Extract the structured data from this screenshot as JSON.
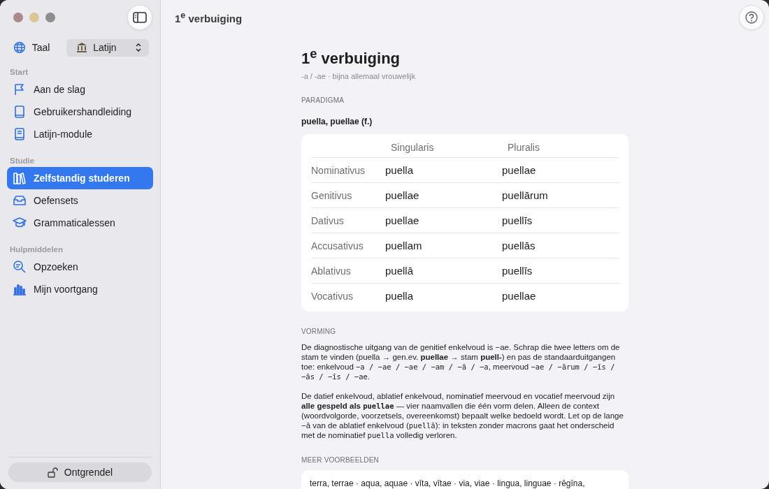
{
  "sidebar": {
    "language": {
      "label": "Taal",
      "value": "Latijn"
    },
    "sections": [
      {
        "title": "Start",
        "items": [
          {
            "label": "Aan de slag",
            "kind": "flag",
            "selected": false
          },
          {
            "label": "Gebruikershandleiding",
            "kind": "book",
            "selected": false
          },
          {
            "label": "Latijn-module",
            "kind": "bookpage",
            "selected": false
          }
        ]
      },
      {
        "title": "Studie",
        "items": [
          {
            "label": "Zelfstandig studeren",
            "kind": "library",
            "selected": true
          },
          {
            "label": "Oefensets",
            "kind": "tray",
            "selected": false
          },
          {
            "label": "Grammaticalessen",
            "kind": "cap",
            "selected": false
          }
        ]
      },
      {
        "title": "Hulpmiddelen",
        "items": [
          {
            "label": "Opzoeken",
            "kind": "search",
            "selected": false
          },
          {
            "label": "Mijn voortgang",
            "kind": "chart",
            "selected": false
          }
        ]
      }
    ],
    "unlock_button": "Ontgrendel"
  },
  "toolbar": {
    "title": "1$^{e}$ verbuiging"
  },
  "page": {
    "title": "1$^{e}$ verbuiging",
    "subtitle": "-a / -ae · bijna allemaal vrouwelijk",
    "paradigm_heading": "PARADIGMA",
    "lemma": "puella, puellae (f.)",
    "table": {
      "columns": [
        "Singularis",
        "Pluralis"
      ],
      "rows": [
        {
          "case": "Nominativus",
          "singular": "puella",
          "plural": "puellae"
        },
        {
          "case": "Genitivus",
          "singular": "puellae",
          "plural": "puellārum"
        },
        {
          "case": "Dativus",
          "singular": "puellae",
          "plural": "puellīs"
        },
        {
          "case": "Accusativus",
          "singular": "puellam",
          "plural": "puellās"
        },
        {
          "case": "Ablativus",
          "singular": "puellā",
          "plural": "puellīs"
        },
        {
          "case": "Vocativus",
          "singular": "puella",
          "plural": "puellae"
        }
      ]
    },
    "formation_heading": "VORMING",
    "paragraphs": [
      [
        {
          "kind": "plain",
          "text": "De diagnostische uitgang van de genitief enkelvoud is −ae. Schrap die twee letters om de stam te vinden (puella → gen.ev. "
        },
        {
          "kind": "bold",
          "text": "puellae"
        },
        {
          "kind": "plain",
          "text": " → stam "
        },
        {
          "kind": "bold",
          "text": "puell-"
        },
        {
          "kind": "plain",
          "text": ") en pas de standaarduitgangen toe: enkelvoud "
        },
        {
          "kind": "mono",
          "text": "−a / −ae / −ae / −am / −ā / −a"
        },
        {
          "kind": "plain",
          "text": ", meervoud "
        },
        {
          "kind": "mono",
          "text": "−ae / −ārum / −īs / −ās / −īs / −ae"
        },
        {
          "kind": "plain",
          "text": "."
        }
      ],
      [
        {
          "kind": "plain",
          "text": "De datief enkelvoud, ablatief enkelvoud, nominatief meervoud en vocatief meervoud zijn "
        },
        {
          "kind": "bold",
          "text": "alle gespeld als "
        },
        {
          "kind": "boldmono",
          "text": "puellae"
        },
        {
          "kind": "plain",
          "text": " — vier naamvallen die één vorm delen. Alleen de context (woordvolgorde, voorzetsels, overeenkomst) bepaalt welke bedoeld wordt. Let op de lange −ā van de ablatief enkelvoud ("
        },
        {
          "kind": "mono",
          "text": "puellā"
        },
        {
          "kind": "plain",
          "text": "): in teksten zonder macrons gaat het onderscheid met de nominatief "
        },
        {
          "kind": "mono",
          "text": "puella"
        },
        {
          "kind": "plain",
          "text": " volledig verloren."
        }
      ]
    ],
    "examples_heading": "MEER VOORBEELDEN",
    "examples": "terra, terrae · aqua, aquae · vīta, vītae · via, viae · lingua, linguae · rēgīna,"
  }
}
